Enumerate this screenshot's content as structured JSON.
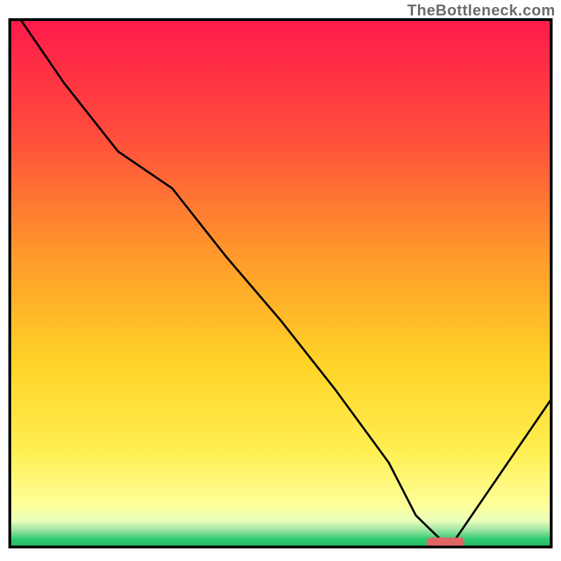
{
  "watermark": "TheBottleneck.com",
  "chart_data": {
    "type": "line",
    "title": "",
    "xlabel": "",
    "ylabel": "",
    "xlim": [
      0,
      100
    ],
    "ylim": [
      0,
      100
    ],
    "grid": false,
    "legend": false,
    "series": [
      {
        "name": "bottleneck-curve",
        "x": [
          2,
          10,
          20,
          30,
          40,
          50,
          60,
          70,
          75,
          80,
          82,
          100
        ],
        "y": [
          100,
          88,
          75,
          68,
          55,
          43,
          30,
          16,
          6,
          1,
          1,
          28
        ]
      }
    ],
    "marker": {
      "name": "optimal-range",
      "x_start": 77,
      "x_end": 84,
      "y": 1,
      "color": "#e06666"
    },
    "background_gradient": {
      "top": "#ff1a4a",
      "upper_mid": "#ff8a2a",
      "mid": "#ffd327",
      "lower_mid": "#ffff7a",
      "green_band": "#2ecc71",
      "bottom": "#ffffff"
    },
    "frame_color": "#000000"
  }
}
